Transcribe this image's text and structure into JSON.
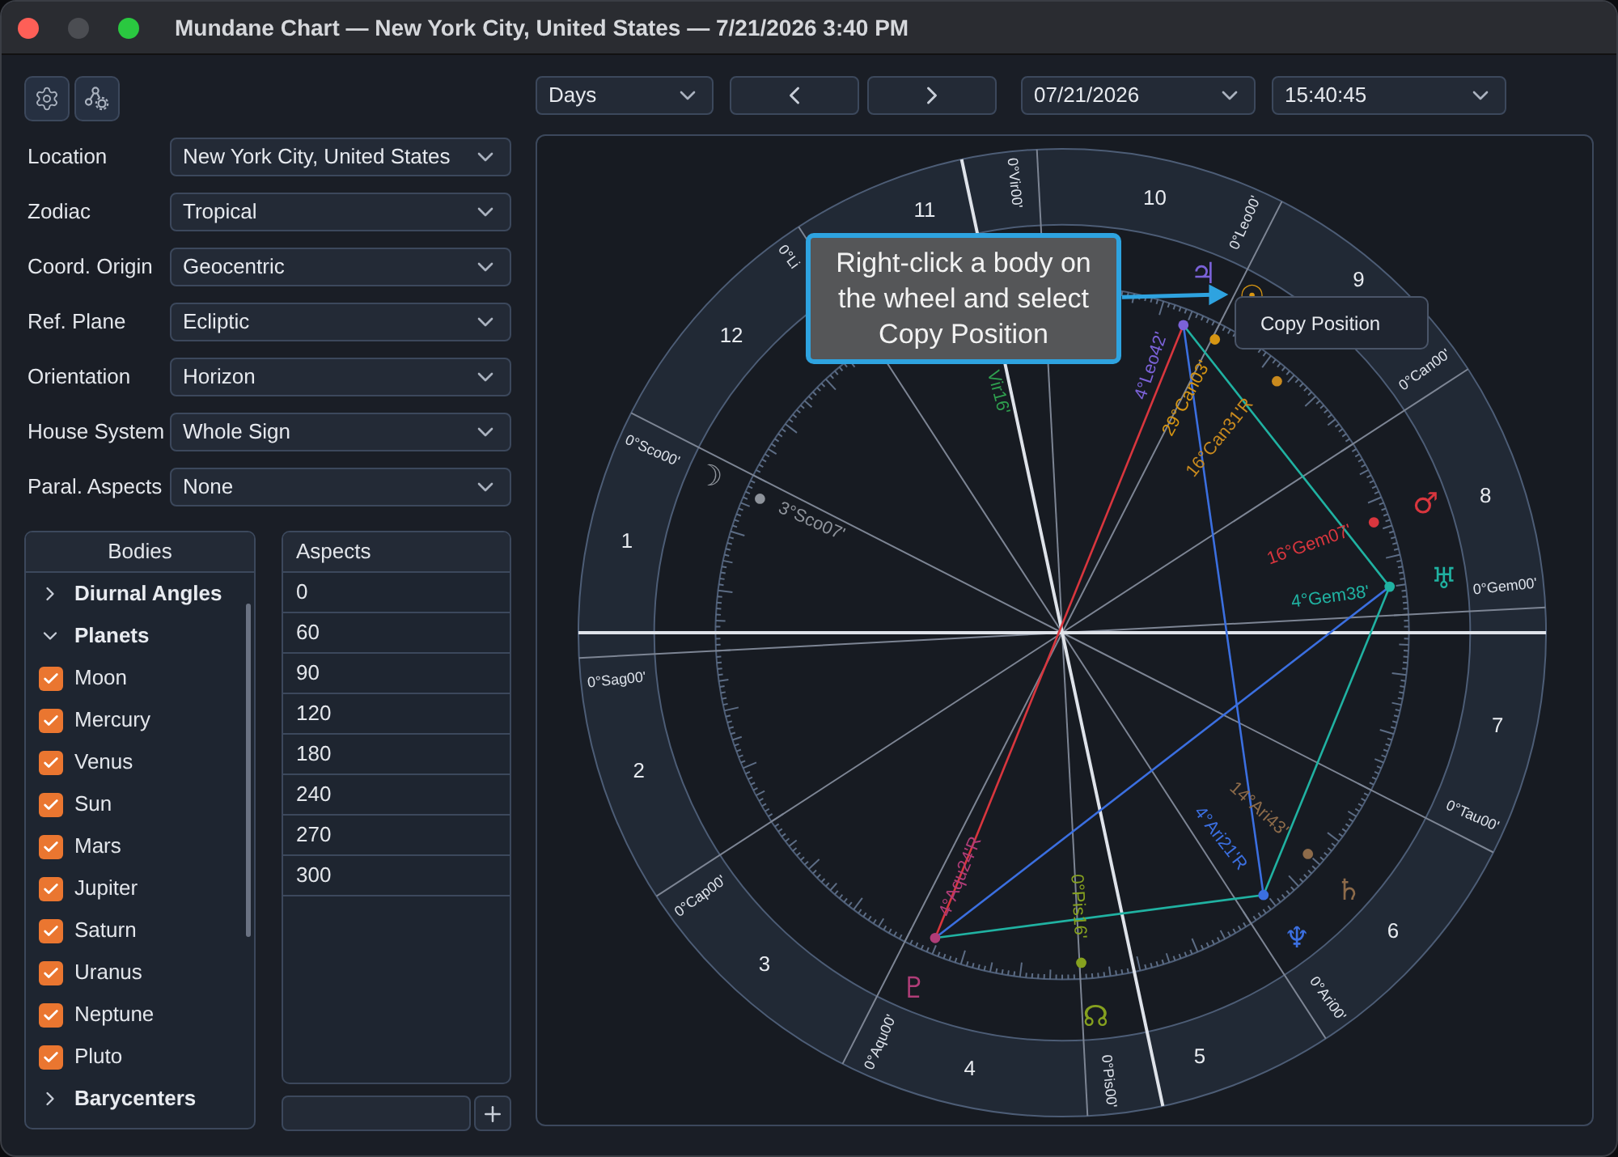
{
  "window": {
    "title": "Mundane Chart — New York City, United States — 7/21/2026 3:40 PM"
  },
  "settings": [
    {
      "label": "Location",
      "value": "New York City, United States"
    },
    {
      "label": "Zodiac",
      "value": "Tropical"
    },
    {
      "label": "Coord. Origin",
      "value": "Geocentric"
    },
    {
      "label": "Ref. Plane",
      "value": "Ecliptic"
    },
    {
      "label": "Orientation",
      "value": "Horizon"
    },
    {
      "label": "House System",
      "value": "Whole Sign"
    },
    {
      "label": "Paral. Aspects",
      "value": "None"
    }
  ],
  "bodies": {
    "header": "Bodies",
    "tree": [
      {
        "label": "Diurnal Angles",
        "expanded": false
      },
      {
        "label": "Planets",
        "expanded": true,
        "children": [
          {
            "label": "Moon",
            "checked": true
          },
          {
            "label": "Mercury",
            "checked": true
          },
          {
            "label": "Venus",
            "checked": true
          },
          {
            "label": "Sun",
            "checked": true
          },
          {
            "label": "Mars",
            "checked": true
          },
          {
            "label": "Jupiter",
            "checked": true
          },
          {
            "label": "Saturn",
            "checked": true
          },
          {
            "label": "Uranus",
            "checked": true
          },
          {
            "label": "Neptune",
            "checked": true
          },
          {
            "label": "Pluto",
            "checked": true
          }
        ]
      },
      {
        "label": "Barycenters",
        "expanded": false
      }
    ]
  },
  "aspects": {
    "header": "Aspects",
    "rows": [
      "0",
      "60",
      "90",
      "120",
      "180",
      "240",
      "270",
      "300"
    ]
  },
  "chart_controls": {
    "step": "Days",
    "date": "07/21/2026",
    "time": "15:40:45"
  },
  "wheel": {
    "houses": [
      "1",
      "2",
      "3",
      "4",
      "5",
      "6",
      "7",
      "8",
      "9",
      "10",
      "11",
      "12"
    ],
    "sign_cusps": [
      "0°Sco00'",
      "0°Sag00'",
      "0°Cap00'",
      "0°Aqu00'",
      "0°Pis00'",
      "0°Ari00'",
      "0°Tau00'",
      "0°Gem00'",
      "0°Can00'",
      "0°Leo00'",
      "0°Vir00'",
      "0°Li"
    ],
    "bodies": [
      {
        "glyph": "☽",
        "label": "3°Sco07'",
        "color": "#8e939b"
      },
      {
        "label": "Vir16'",
        "color": "#2fa04f"
      },
      {
        "label": "16°Can31'R",
        "color": "#c98a1e"
      },
      {
        "glyph": "☉",
        "label": "29°Can03'",
        "color": "#d69512"
      },
      {
        "glyph": "♂",
        "label": "16°Gem07'",
        "color": "#d9363e"
      },
      {
        "glyph": "♃",
        "label": "4°Leo42'",
        "color": "#7b62d8"
      },
      {
        "glyph": "♄",
        "label": "14°Ari43'",
        "color": "#8d6b4a"
      },
      {
        "glyph": "♅",
        "label": "4°Gem38'",
        "color": "#20b2a2"
      },
      {
        "glyph": "♆",
        "label": "4°Ari21'R",
        "color": "#3b6fe0"
      },
      {
        "glyph": "♇",
        "label": "4°Aqu24'R",
        "color": "#b03d78"
      },
      {
        "glyph": "☊",
        "label": "0°Pis16'",
        "color": "#86a11f"
      }
    ]
  },
  "callout": {
    "text": "Right-click a body on the wheel and select Copy Position"
  },
  "context_menu": {
    "items": [
      "Copy Position"
    ]
  }
}
